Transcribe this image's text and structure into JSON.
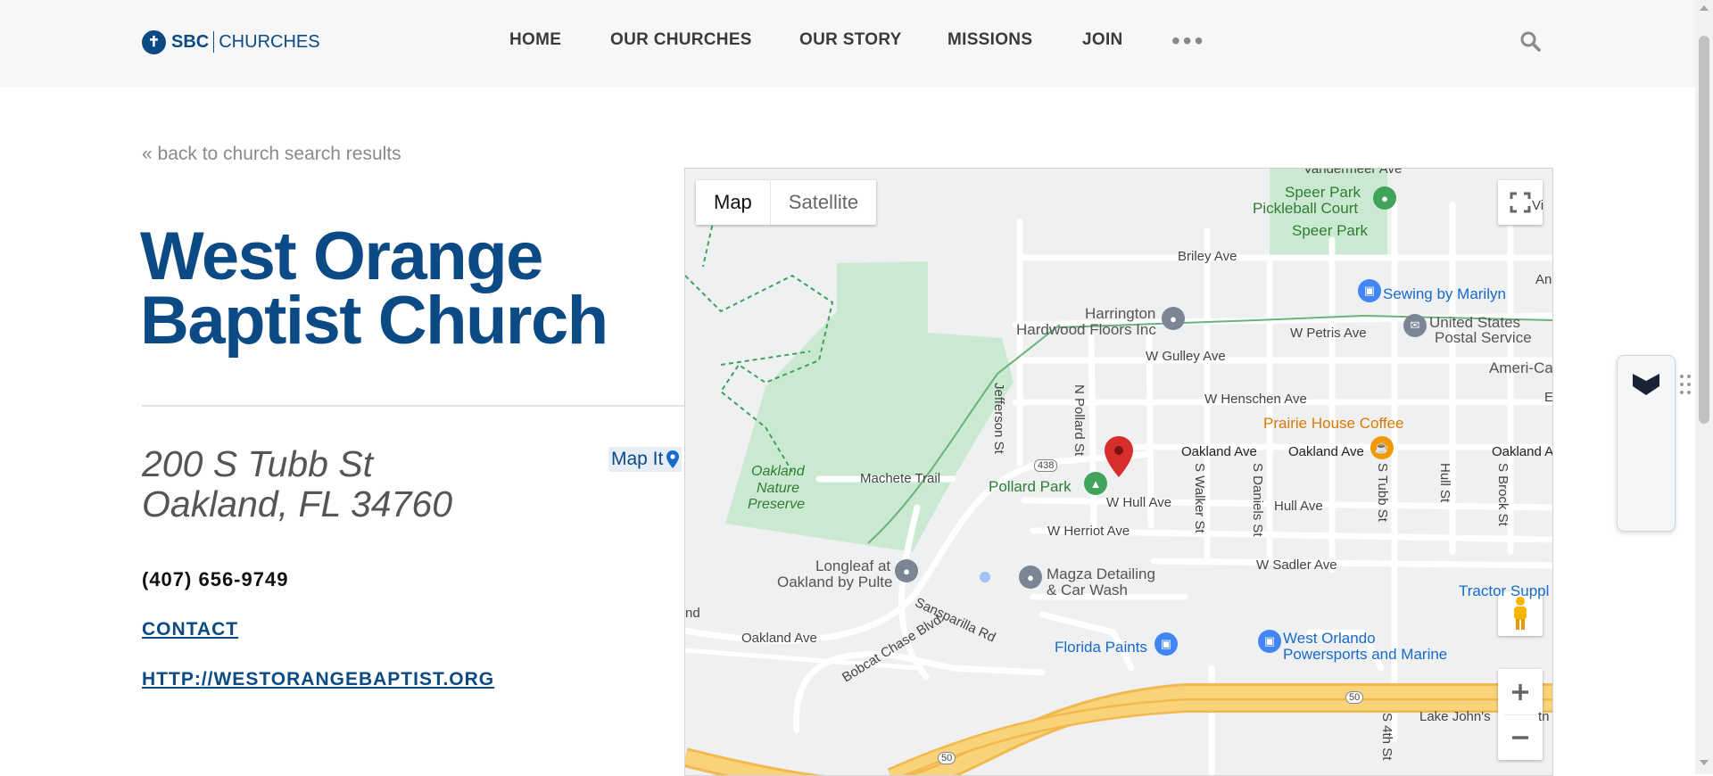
{
  "header": {
    "logo_sbc": "SBC",
    "logo_churches": "CHURCHES",
    "nav": [
      "HOME",
      "OUR CHURCHES",
      "OUR STORY",
      "MISSIONS",
      "JOIN"
    ],
    "more": "•••"
  },
  "back_link": "« back to church search results",
  "church": {
    "name_line1": "West Orange",
    "name_line2": "Baptist Church",
    "address_line1": "200 S Tubb St",
    "address_line2": "Oakland, FL 34760",
    "map_it": "Map It",
    "phone": "(407) 656-9749",
    "contact": "CONTACT",
    "website": "HTTP://WESTORANGEBAPTIST.ORG"
  },
  "map": {
    "type_map": "Map",
    "type_satellite": "Satellite",
    "labels": {
      "speer_park_court_1": "Speer Park",
      "speer_park_court_2": "Pickleball Court",
      "speer_park": "Speer Park",
      "briley": "Briley Ave",
      "sewing": "Sewing by Marilyn",
      "harrington_1": "Harrington",
      "harrington_2": "Hardwood Floors Inc",
      "w_petris": "W Petris Ave",
      "usps_1": "United States",
      "usps_2": "Postal Service",
      "w_gulley": "W Gulley Ave",
      "ameri": "Ameri-Ca",
      "w_henschen": "W Henschen Ave",
      "jefferson": "Jefferson St",
      "n_pollard": "N Pollard St",
      "prairie": "Prairie House Coffee",
      "oakland_ave_1": "Oakland Ave",
      "oakland_ave_2": "Oakland Ave",
      "oakland_ave_3": "Oakland A",
      "route_438": "438",
      "pollard_park": "Pollard Park",
      "w_hull": "W Hull Ave",
      "hull_ave": "Hull Ave",
      "s_walker": "S Walker St",
      "s_daniels": "S Daniels St",
      "s_tubb": "S Tubb St",
      "hull_st": "Hull St",
      "s_brock": "S Brock St",
      "oakland_nature_1": "Oakland",
      "oakland_nature_2": "Nature",
      "oakland_nature_3": "Preserve",
      "machete": "Machete Trail",
      "w_herriot": "W Herriot Ave",
      "w_sadler": "W Sadler Ave",
      "longleaf_1": "Longleaf at",
      "longleaf_2": "Oakland by Pulte",
      "magza_1": "Magza Detailing",
      "magza_2": "& Car Wash",
      "sansparilla": "Sansparilla Rd",
      "tractor": "Tractor Suppl",
      "nd": "nd",
      "oakland_ave_sw": "Oakland Ave",
      "bobcat": "Bobcat Chase Blvd",
      "florida_paints": "Florida Paints",
      "west_orlando_1": "West Orlando",
      "west_orlando_2": "Powersports and Marine",
      "route_50_a": "50",
      "route_50_b": "50",
      "lake_johns": "Lake John's",
      "s_4th": "S 4th St",
      "vandermeer": "Vandermeer Ave",
      "vi": "Vi",
      "an": "An",
      "e": "E",
      "rt": "tn"
    }
  },
  "colors": {
    "brand_blue": "#0b4a85",
    "park_green": "#cbe9d1",
    "highway_yellow": "#f6c760",
    "marker_red": "#d62d2d"
  }
}
